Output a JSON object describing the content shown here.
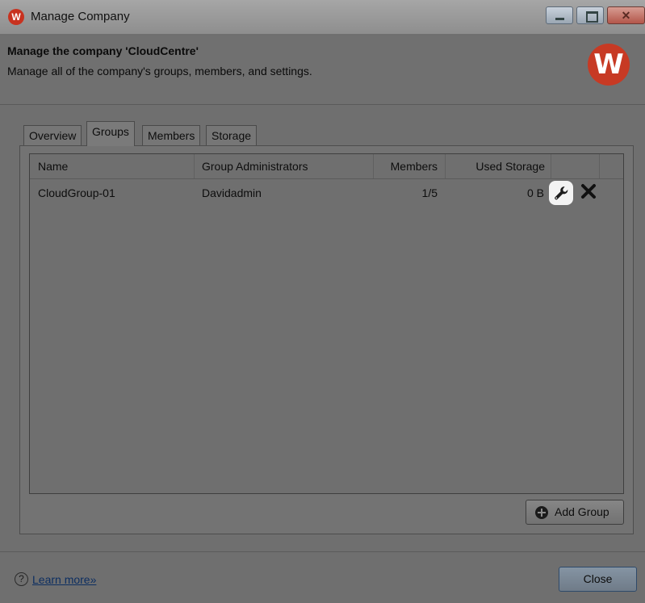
{
  "window": {
    "icon_letter": "W",
    "title": "Manage Company",
    "close_glyph": "✕"
  },
  "header": {
    "title": "Manage the company 'CloudCentre'",
    "subtitle": "Manage all of the company's groups, members, and settings.",
    "logo_letter": "W"
  },
  "tabs": [
    {
      "label": "Overview",
      "active": false
    },
    {
      "label": "Groups",
      "active": true
    },
    {
      "label": "Members",
      "active": false
    },
    {
      "label": "Storage",
      "active": false
    }
  ],
  "table": {
    "columns": [
      "Name",
      "Group Administrators",
      "Members",
      "Used Storage"
    ],
    "rows": [
      {
        "name": "CloudGroup-01",
        "admins": "Davidadmin",
        "members": "1/5",
        "storage": "0 B"
      }
    ],
    "row_actions": [
      "wrench-icon",
      "close-icon"
    ]
  },
  "buttons": {
    "add_group": "Add Group",
    "close": "Close"
  },
  "footer": {
    "help_glyph": "?",
    "learn_more": "Learn more»"
  },
  "colors": {
    "brand": "#c73a24",
    "link": "#0c2e61"
  }
}
